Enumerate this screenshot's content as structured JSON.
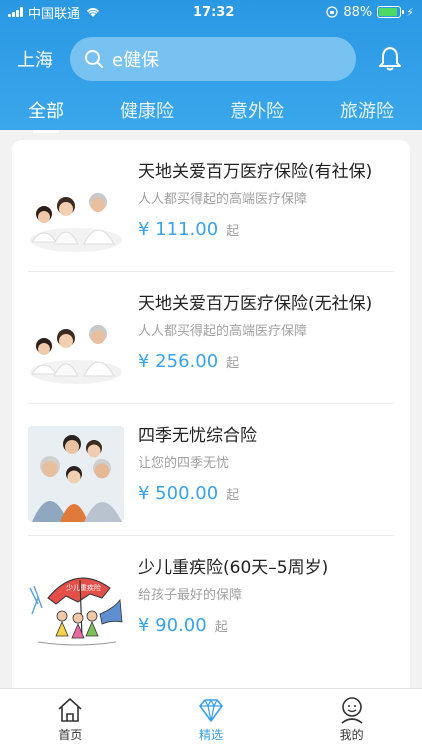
{
  "status": {
    "carrier": "中国联通",
    "time": "17:32",
    "battery": "88%",
    "battery_level": 0.88
  },
  "header": {
    "city": "上海",
    "search_placeholder": "e健保",
    "tabs": [
      {
        "label": "全部",
        "active": true
      },
      {
        "label": "健康险",
        "active": false
      },
      {
        "label": "意外险",
        "active": false
      },
      {
        "label": "旅游险",
        "active": false
      }
    ]
  },
  "products": [
    {
      "title": "天地关爱百万医疗保险(有社保)",
      "subtitle": "人人都买得起的高端医疗保障",
      "price": "¥ 111.00",
      "unit": "起",
      "image": "family-photo"
    },
    {
      "title": "天地关爱百万医疗保险(无社保)",
      "subtitle": "人人都买得起的高端医疗保障",
      "price": "¥ 256.00",
      "unit": "起",
      "image": "family-photo"
    },
    {
      "title": "四季无忧综合险",
      "subtitle": "让您的四季无忧",
      "price": "¥ 500.00",
      "unit": "起",
      "image": "family-group-photo"
    },
    {
      "title": "少儿重疾险(60天–5周岁)",
      "subtitle": "给孩子最好的保障",
      "price": "¥ 90.00",
      "unit": "起",
      "image": "umbrella-illustration",
      "image_text": "少儿重疾险"
    }
  ],
  "tabbar": [
    {
      "label": "首页",
      "icon": "home-icon",
      "active": false
    },
    {
      "label": "精选",
      "icon": "diamond-icon",
      "active": true
    },
    {
      "label": "我的",
      "icon": "profile-icon",
      "active": false
    }
  ],
  "colors": {
    "primary": "#2a97e3",
    "price": "#38a3ec"
  }
}
